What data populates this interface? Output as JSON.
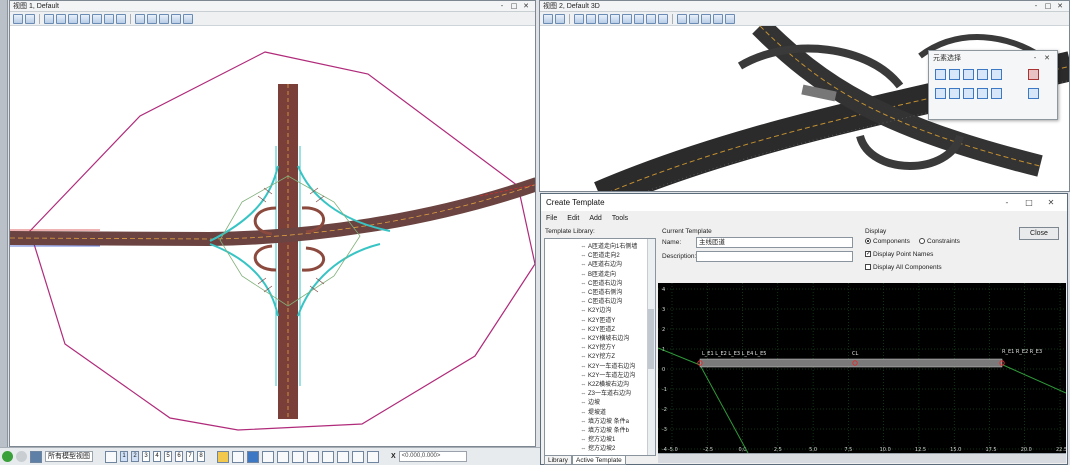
{
  "views": {
    "plan": {
      "title": "视图 1, Default"
    },
    "three_d": {
      "title": "视图 2, Default 3D"
    }
  },
  "window_buttons": {
    "minimize": "-",
    "maximize": "□",
    "close": "✕"
  },
  "palette": {
    "title": "元素选择",
    "minimize": "-",
    "close": "✕"
  },
  "dialog": {
    "title": "Create Template",
    "menu": [
      "File",
      "Edit",
      "Add",
      "Tools"
    ],
    "library_label": "Template Library:",
    "library_items": [
      "A匝道走向1右侧墙",
      "C匝道走向2",
      "A匝道右边沟",
      "B匝道走向",
      "C匝道右边沟",
      "C匝道右侧沟",
      "C匝道右边沟",
      "K2Y边沟",
      "K2Y匝道Y",
      "K2Y匝道Z",
      "K2Y横坡右边沟",
      "K2Y挖方Y",
      "K2Y挖方Z",
      "K2Y一车道右边沟",
      "K2Y一车道左边沟",
      "K2Z横坡右边沟",
      "Z3一车道右边沟",
      "边坡",
      "堤坡道",
      "填方边坡 条件a",
      "填方边坡 条件b",
      "挖方边坡1",
      "挖方边坡2"
    ],
    "tabs": [
      "Library",
      "Active Template"
    ],
    "current_template_label": "Current Template",
    "name_label": "Name:",
    "name_value": "主线匝道",
    "description_label": "Description:",
    "description_value": "",
    "display_label": "Display",
    "display_components": "Components",
    "display_constraints": "Constraints",
    "display_point_names": "Display Point Names",
    "display_all_components": "Display All Components",
    "close_label": "Close",
    "grid_y_ticks": [
      "4",
      "3",
      "2",
      "1",
      "0",
      "-1",
      "-2",
      "-3",
      "-4"
    ],
    "grid_x_ticks": [
      "-5.0",
      "-2.5",
      "0.0",
      "2.5",
      "5.0",
      "7.5",
      "10.0",
      "12.5",
      "15.0",
      "17.5",
      "20.0",
      "22.5"
    ],
    "point_labels_left": "L_E1 L_E2 L_E3 L_E4 L_E5",
    "point_label_center": "CL",
    "point_labels_right": "R_E1 R_E2 R_E3"
  },
  "statusbar": {
    "model_select": "所有模型视图",
    "view_numbers": [
      "1",
      "2",
      "3",
      "4",
      "5",
      "6",
      "7",
      "8"
    ],
    "x_label": "X",
    "coord_value": "<0.000,0.000>"
  },
  "colors": {
    "accent": "#3d78c4",
    "road_dark": "#7b3f3a",
    "road_cyan": "#38c4c4",
    "boundary_magenta": "#b02a7a",
    "grid_bg": "#000000",
    "grid_green": "#1f6a28"
  }
}
